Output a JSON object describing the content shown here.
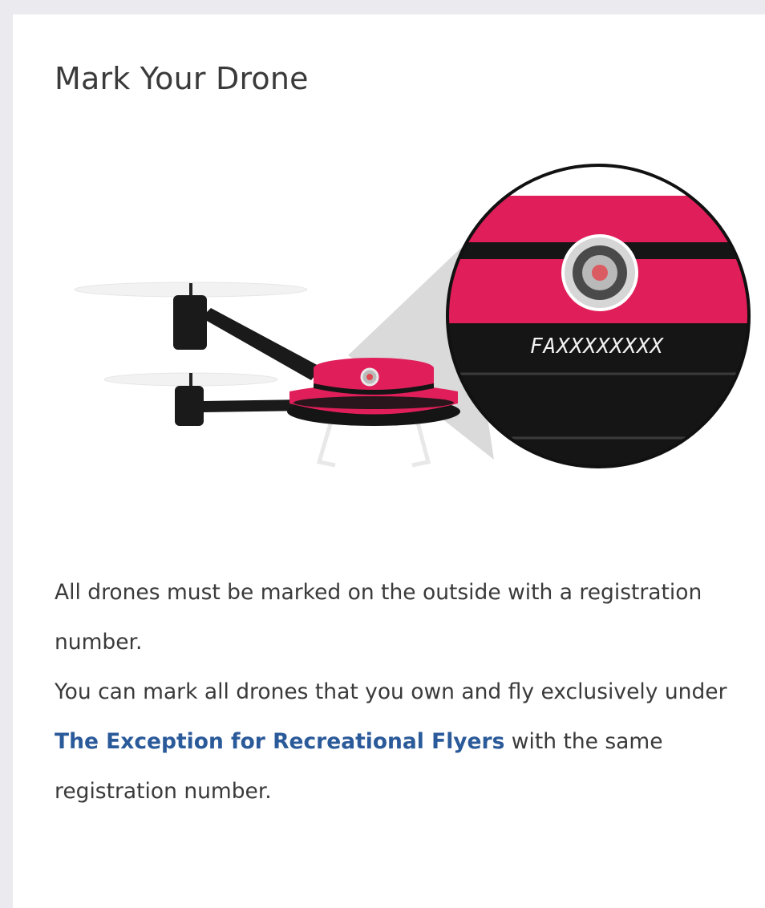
{
  "card": {
    "title": "Mark Your Drone",
    "illustration": {
      "marking_text": "FAXXXXXXXX",
      "colors": {
        "body_pink": "#e01e5a",
        "body_black": "#151515",
        "lens_gray": "#c8c8c8",
        "lens_red": "#e04a52",
        "magnifier_cone": "#d3d3d3",
        "propeller": "#f2f2f2"
      }
    },
    "description": {
      "paragraph1": "All drones must be marked on the outside with a registration number.",
      "paragraph2_before": "You can mark all drones that you own and fly exclusively under ",
      "link_text": "The Exception for Recreational Flyers",
      "paragraph2_after": " with the same registration number."
    },
    "colors": {
      "link": "#2b5a9a",
      "text": "#3a3a3a",
      "page_background": "#ebeaef",
      "card_background": "#ffffff"
    }
  }
}
